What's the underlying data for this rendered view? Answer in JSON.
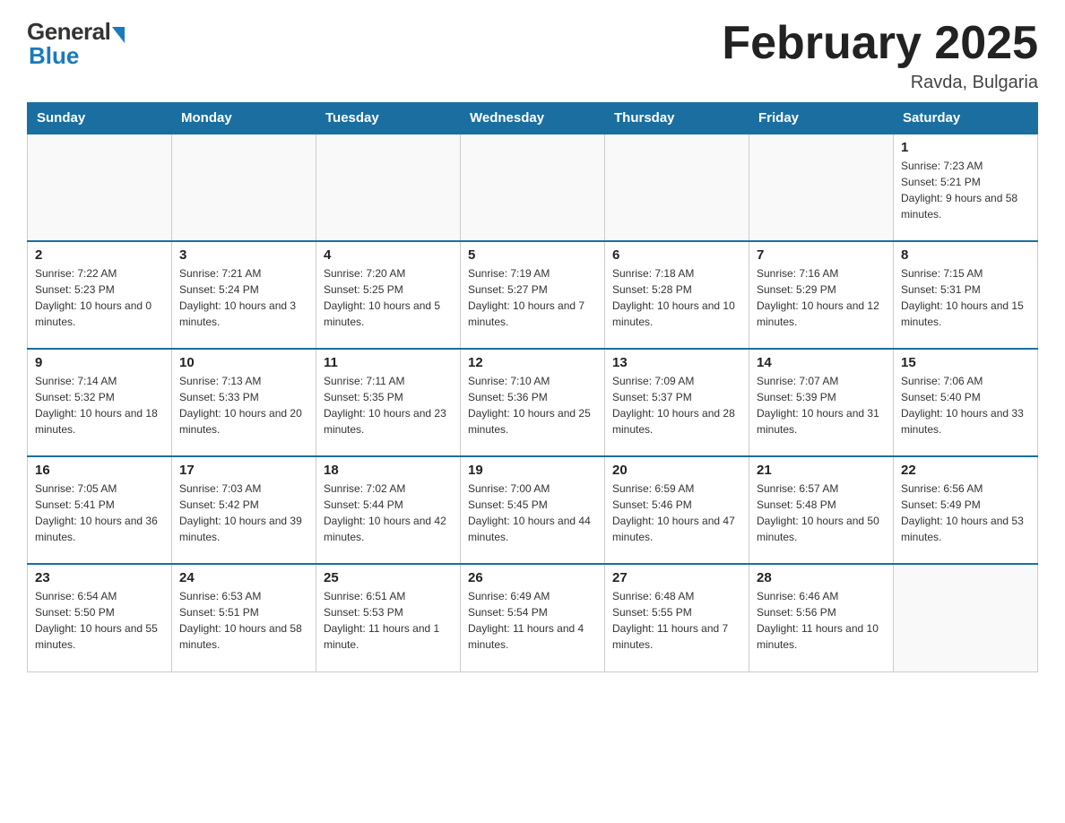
{
  "header": {
    "logo_general": "General",
    "logo_blue": "Blue",
    "month_title": "February 2025",
    "location": "Ravda, Bulgaria"
  },
  "days_of_week": [
    "Sunday",
    "Monday",
    "Tuesday",
    "Wednesday",
    "Thursday",
    "Friday",
    "Saturday"
  ],
  "weeks": [
    [
      {
        "day": "",
        "info": ""
      },
      {
        "day": "",
        "info": ""
      },
      {
        "day": "",
        "info": ""
      },
      {
        "day": "",
        "info": ""
      },
      {
        "day": "",
        "info": ""
      },
      {
        "day": "",
        "info": ""
      },
      {
        "day": "1",
        "info": "Sunrise: 7:23 AM\nSunset: 5:21 PM\nDaylight: 9 hours and 58 minutes."
      }
    ],
    [
      {
        "day": "2",
        "info": "Sunrise: 7:22 AM\nSunset: 5:23 PM\nDaylight: 10 hours and 0 minutes."
      },
      {
        "day": "3",
        "info": "Sunrise: 7:21 AM\nSunset: 5:24 PM\nDaylight: 10 hours and 3 minutes."
      },
      {
        "day": "4",
        "info": "Sunrise: 7:20 AM\nSunset: 5:25 PM\nDaylight: 10 hours and 5 minutes."
      },
      {
        "day": "5",
        "info": "Sunrise: 7:19 AM\nSunset: 5:27 PM\nDaylight: 10 hours and 7 minutes."
      },
      {
        "day": "6",
        "info": "Sunrise: 7:18 AM\nSunset: 5:28 PM\nDaylight: 10 hours and 10 minutes."
      },
      {
        "day": "7",
        "info": "Sunrise: 7:16 AM\nSunset: 5:29 PM\nDaylight: 10 hours and 12 minutes."
      },
      {
        "day": "8",
        "info": "Sunrise: 7:15 AM\nSunset: 5:31 PM\nDaylight: 10 hours and 15 minutes."
      }
    ],
    [
      {
        "day": "9",
        "info": "Sunrise: 7:14 AM\nSunset: 5:32 PM\nDaylight: 10 hours and 18 minutes."
      },
      {
        "day": "10",
        "info": "Sunrise: 7:13 AM\nSunset: 5:33 PM\nDaylight: 10 hours and 20 minutes."
      },
      {
        "day": "11",
        "info": "Sunrise: 7:11 AM\nSunset: 5:35 PM\nDaylight: 10 hours and 23 minutes."
      },
      {
        "day": "12",
        "info": "Sunrise: 7:10 AM\nSunset: 5:36 PM\nDaylight: 10 hours and 25 minutes."
      },
      {
        "day": "13",
        "info": "Sunrise: 7:09 AM\nSunset: 5:37 PM\nDaylight: 10 hours and 28 minutes."
      },
      {
        "day": "14",
        "info": "Sunrise: 7:07 AM\nSunset: 5:39 PM\nDaylight: 10 hours and 31 minutes."
      },
      {
        "day": "15",
        "info": "Sunrise: 7:06 AM\nSunset: 5:40 PM\nDaylight: 10 hours and 33 minutes."
      }
    ],
    [
      {
        "day": "16",
        "info": "Sunrise: 7:05 AM\nSunset: 5:41 PM\nDaylight: 10 hours and 36 minutes."
      },
      {
        "day": "17",
        "info": "Sunrise: 7:03 AM\nSunset: 5:42 PM\nDaylight: 10 hours and 39 minutes."
      },
      {
        "day": "18",
        "info": "Sunrise: 7:02 AM\nSunset: 5:44 PM\nDaylight: 10 hours and 42 minutes."
      },
      {
        "day": "19",
        "info": "Sunrise: 7:00 AM\nSunset: 5:45 PM\nDaylight: 10 hours and 44 minutes."
      },
      {
        "day": "20",
        "info": "Sunrise: 6:59 AM\nSunset: 5:46 PM\nDaylight: 10 hours and 47 minutes."
      },
      {
        "day": "21",
        "info": "Sunrise: 6:57 AM\nSunset: 5:48 PM\nDaylight: 10 hours and 50 minutes."
      },
      {
        "day": "22",
        "info": "Sunrise: 6:56 AM\nSunset: 5:49 PM\nDaylight: 10 hours and 53 minutes."
      }
    ],
    [
      {
        "day": "23",
        "info": "Sunrise: 6:54 AM\nSunset: 5:50 PM\nDaylight: 10 hours and 55 minutes."
      },
      {
        "day": "24",
        "info": "Sunrise: 6:53 AM\nSunset: 5:51 PM\nDaylight: 10 hours and 58 minutes."
      },
      {
        "day": "25",
        "info": "Sunrise: 6:51 AM\nSunset: 5:53 PM\nDaylight: 11 hours and 1 minute."
      },
      {
        "day": "26",
        "info": "Sunrise: 6:49 AM\nSunset: 5:54 PM\nDaylight: 11 hours and 4 minutes."
      },
      {
        "day": "27",
        "info": "Sunrise: 6:48 AM\nSunset: 5:55 PM\nDaylight: 11 hours and 7 minutes."
      },
      {
        "day": "28",
        "info": "Sunrise: 6:46 AM\nSunset: 5:56 PM\nDaylight: 11 hours and 10 minutes."
      },
      {
        "day": "",
        "info": ""
      }
    ]
  ]
}
